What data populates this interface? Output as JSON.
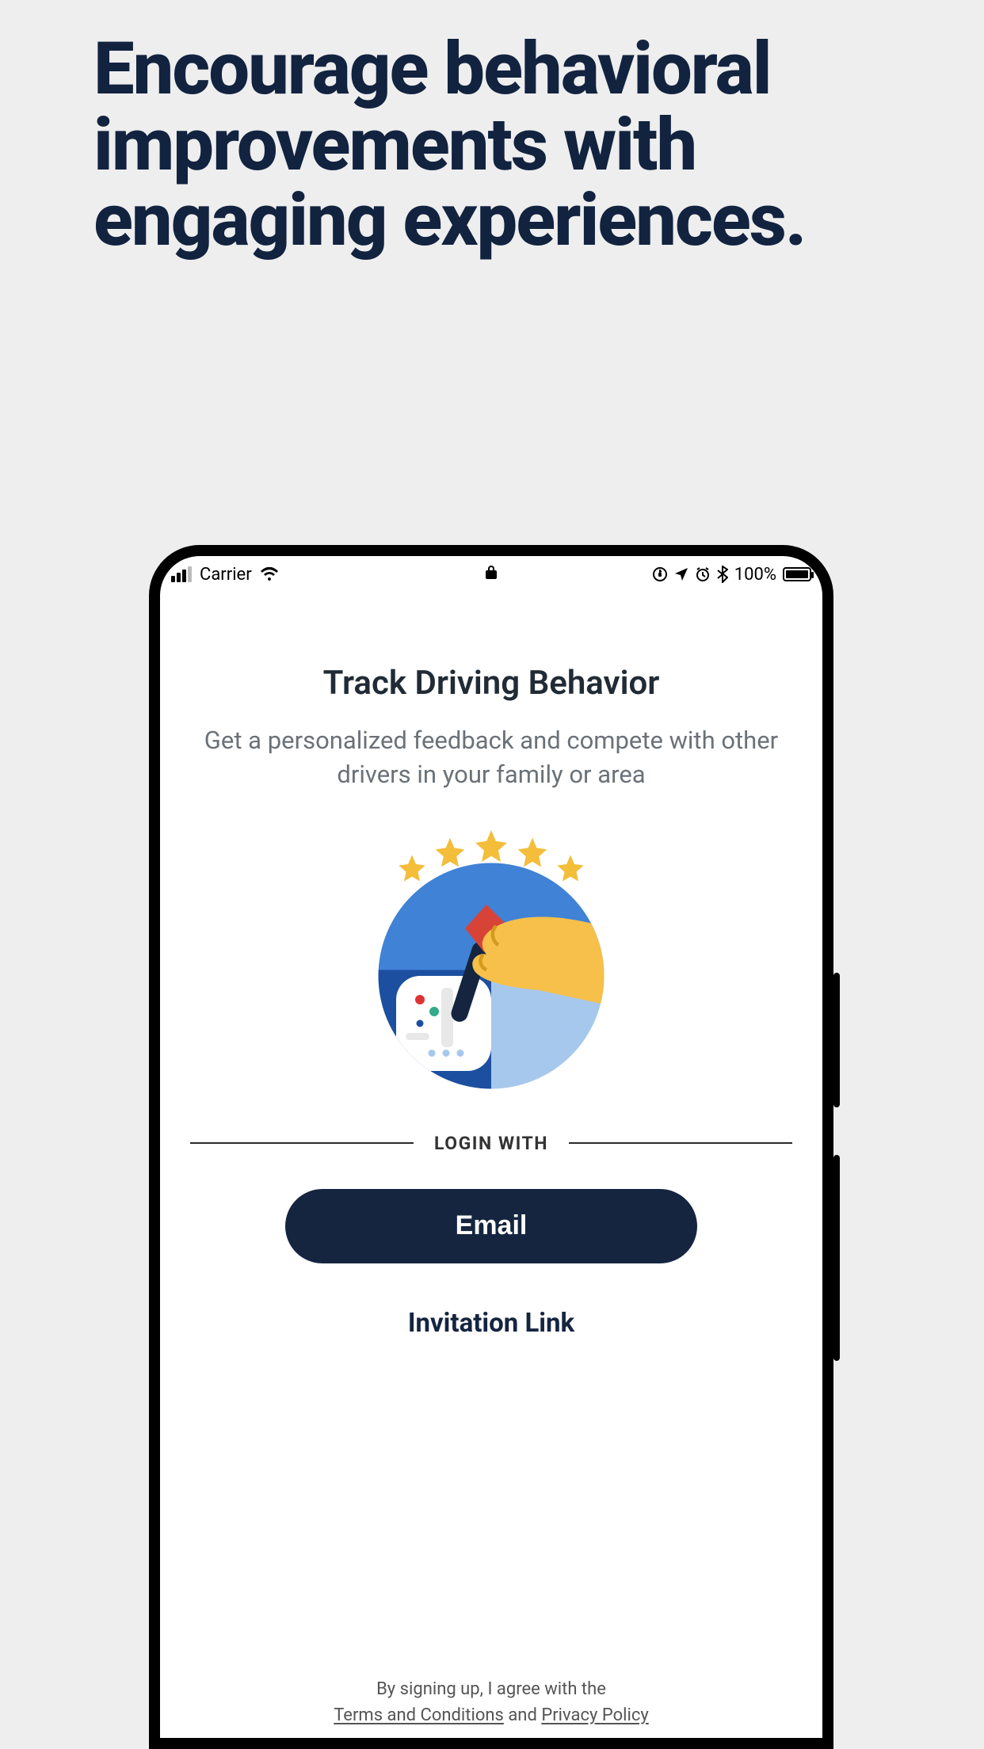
{
  "marketing": {
    "headline": "Encourage behavioral improvements with engaging experiences."
  },
  "status": {
    "carrier": "Carrier",
    "battery_pct": "100%"
  },
  "screen": {
    "title": "Track Driving Behavior",
    "subtitle": "Get a personalized feedback and compete with other drivers in your family or area",
    "login_with_label": "LOGIN WITH",
    "email_button": "Email",
    "invitation_link": "Invitation Link"
  },
  "footer": {
    "intro": "By signing up, I agree with the",
    "terms": "Terms and Conditions",
    "and": " and ",
    "privacy": "Privacy Policy"
  }
}
